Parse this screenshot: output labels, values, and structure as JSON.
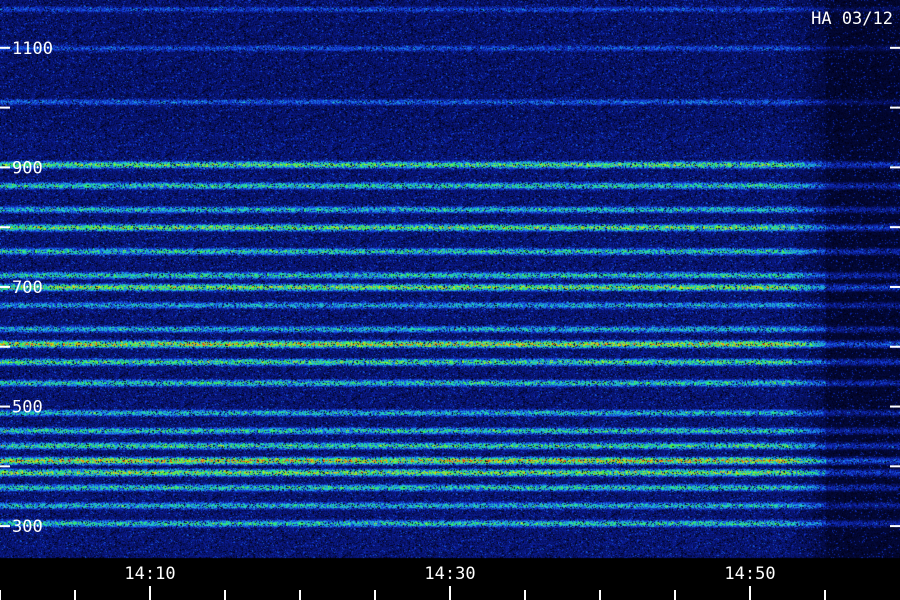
{
  "chart_data": {
    "type": "heatmap",
    "title": "HA 03/12",
    "xlabel": "",
    "ylabel": "",
    "y_unit_ticks": [
      300,
      500,
      700,
      900,
      1100
    ],
    "y_minor_ticks": [
      400,
      600,
      800,
      1000
    ],
    "ylim": [
      250,
      1180
    ],
    "x_ticks": [
      "14:10",
      "14:30",
      "14:50"
    ],
    "x_tick_minutes": [
      10,
      30,
      50
    ],
    "x_minor_minutes": [
      0,
      5,
      15,
      20,
      25,
      35,
      40,
      45,
      55
    ],
    "xlim_minutes": [
      0,
      60
    ],
    "signal_end_minute": 55,
    "colormap": [
      "#000010",
      "#0a1a8c",
      "#1540e0",
      "#1f9fe6",
      "#25e0b0",
      "#3df03a",
      "#c8f020",
      "#f0a010",
      "#e03010"
    ],
    "bands": [
      {
        "freq": 305,
        "intensity": 0.55
      },
      {
        "freq": 335,
        "intensity": 0.5
      },
      {
        "freq": 365,
        "intensity": 0.55
      },
      {
        "freq": 390,
        "intensity": 0.72
      },
      {
        "freq": 410,
        "intensity": 0.85
      },
      {
        "freq": 435,
        "intensity": 0.6
      },
      {
        "freq": 460,
        "intensity": 0.55
      },
      {
        "freq": 490,
        "intensity": 0.5
      },
      {
        "freq": 540,
        "intensity": 0.55
      },
      {
        "freq": 575,
        "intensity": 0.62
      },
      {
        "freq": 605,
        "intensity": 0.82
      },
      {
        "freq": 630,
        "intensity": 0.48
      },
      {
        "freq": 670,
        "intensity": 0.45
      },
      {
        "freq": 700,
        "intensity": 0.72
      },
      {
        "freq": 720,
        "intensity": 0.55
      },
      {
        "freq": 760,
        "intensity": 0.55
      },
      {
        "freq": 800,
        "intensity": 0.68
      },
      {
        "freq": 830,
        "intensity": 0.5
      },
      {
        "freq": 870,
        "intensity": 0.55
      },
      {
        "freq": 905,
        "intensity": 0.65
      },
      {
        "freq": 1010,
        "intensity": 0.35
      },
      {
        "freq": 1100,
        "intensity": 0.32
      },
      {
        "freq": 1165,
        "intensity": 0.3
      }
    ]
  }
}
